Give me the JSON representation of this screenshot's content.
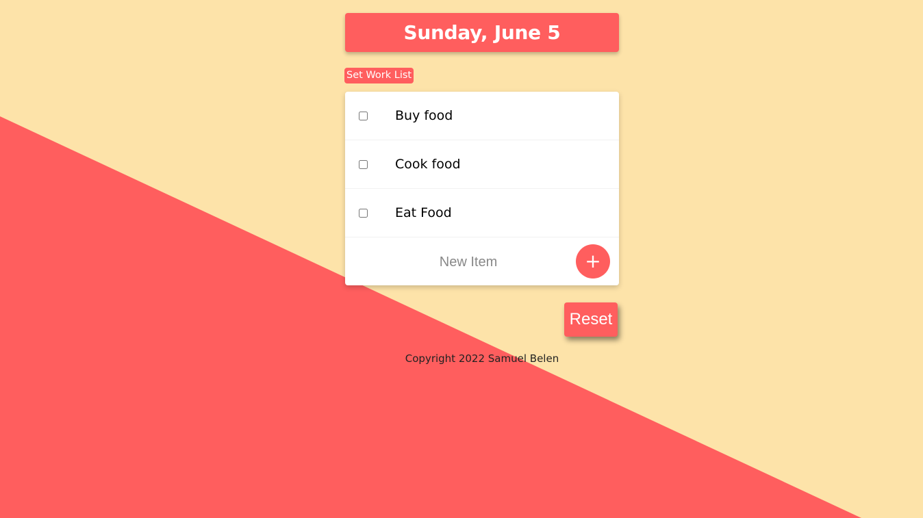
{
  "colors": {
    "background": "#FDE3A9",
    "accent": "#FF5E5E",
    "card": "#FFFFFF",
    "text": "#000000"
  },
  "header": {
    "day_title": "Sunday, June 5"
  },
  "toolbar": {
    "work_list_label": "Set Work List"
  },
  "list": {
    "items": [
      {
        "label": "Buy food",
        "checked": false
      },
      {
        "label": "Cook food",
        "checked": false
      },
      {
        "label": "Eat Food",
        "checked": false
      }
    ],
    "new_item": {
      "placeholder": "New Item",
      "value": ""
    },
    "add_label": "+"
  },
  "actions": {
    "reset_label": "Reset"
  },
  "footer": {
    "copyright": "Copyright 2022 Samuel Belen"
  }
}
